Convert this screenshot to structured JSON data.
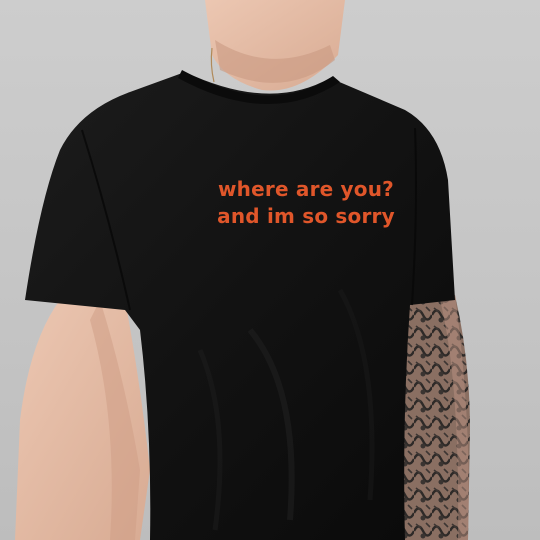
{
  "shirt_print": {
    "line_1": "where are you?",
    "line_2": "and im so sorry"
  },
  "colors": {
    "background": "#c8c8c8",
    "shirt": "#141414",
    "skin": "#e3bca6",
    "print": "#e0562a",
    "tattoo": "#4a4a4a"
  },
  "icons": {
    "necklace": "necklace-chain"
  }
}
